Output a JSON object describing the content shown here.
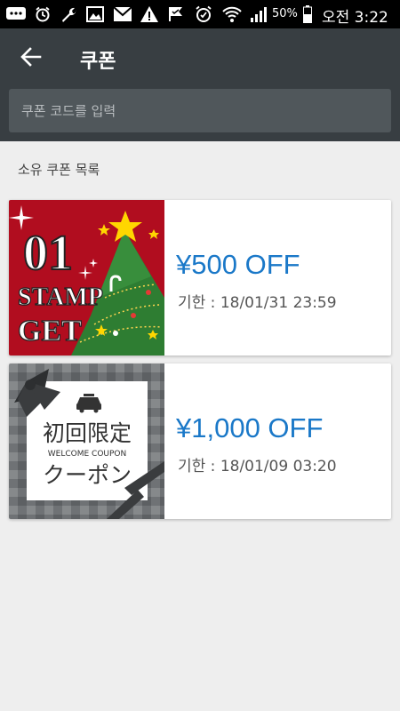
{
  "status_bar": {
    "battery_percent": "50%",
    "time": "오전 3:22",
    "icons": [
      "chat-more-icon",
      "alarm-icon",
      "wrench-icon",
      "image-icon",
      "mail-icon",
      "warning-icon",
      "flag-check-icon",
      "alarm-clock-icon",
      "wifi-icon",
      "signal-icon",
      "battery-icon"
    ]
  },
  "header": {
    "title": "쿠폰",
    "back_icon": "arrow-left-icon",
    "search_placeholder": "쿠폰 코드를 입력"
  },
  "section_label": "소유 쿠폰 목록",
  "coupons": [
    {
      "amount": "¥500 OFF",
      "expiry": "기한 :  18/01/31 23:59",
      "image": {
        "number": "01",
        "line1": "STAMP",
        "line2": "GET"
      }
    },
    {
      "amount": "¥1,000 OFF",
      "expiry": "기한 :  18/01/09 03:20",
      "image": {
        "line1": "初回限定",
        "line2": "WELCOME COUPON",
        "line3": "クーポン"
      }
    }
  ],
  "colors": {
    "status_bar": "#000000",
    "header": "#383e42",
    "search": "#50575b",
    "background": "#eeeeee",
    "accent_blue": "#1a78c8",
    "christmas_red": "#b10d1f",
    "tree_green": "#2e7d32"
  }
}
